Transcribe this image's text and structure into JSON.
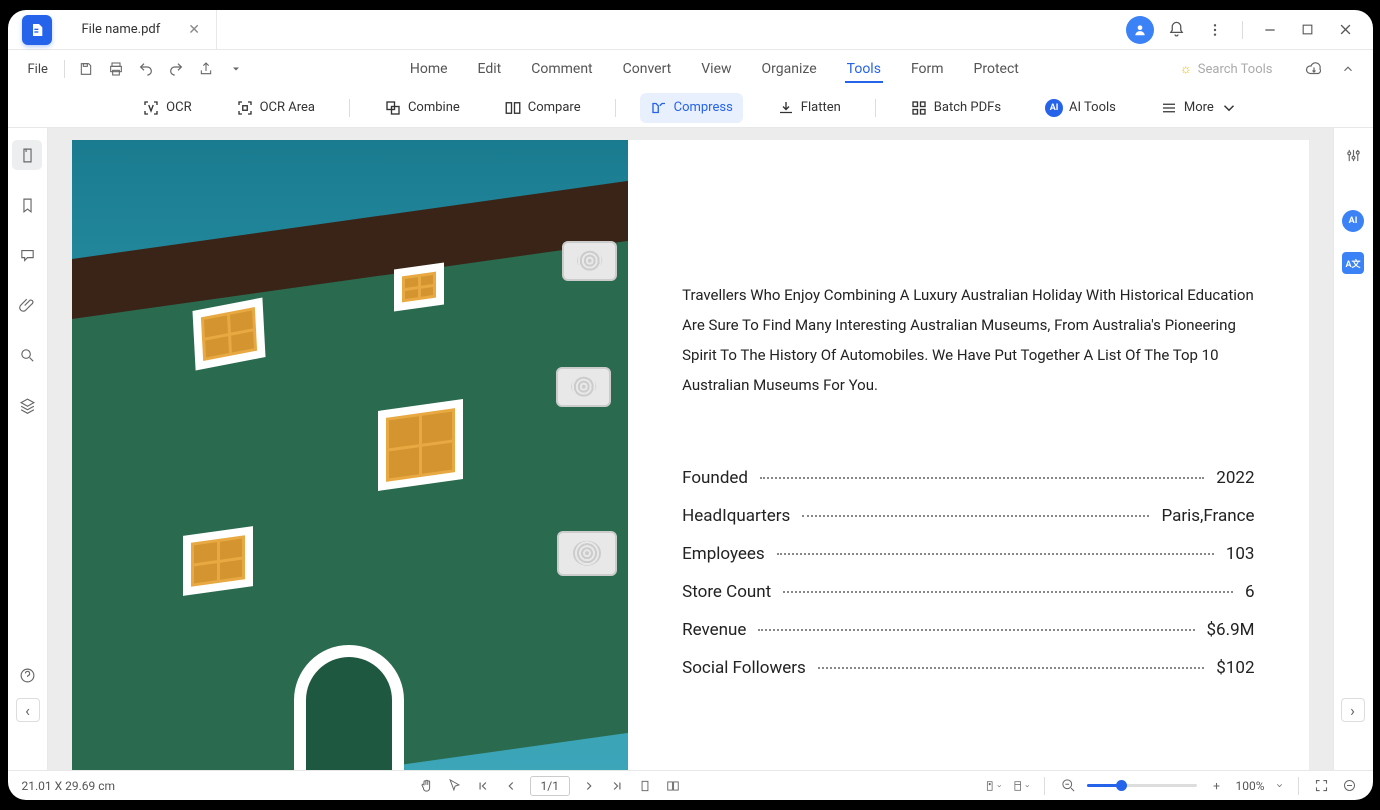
{
  "tab": {
    "filename": "File name.pdf"
  },
  "menubar": {
    "file": "File",
    "items": [
      "Home",
      "Edit",
      "Comment",
      "Convert",
      "View",
      "Organize",
      "Tools",
      "Form",
      "Protect"
    ],
    "active_index": 6,
    "search_placeholder": "Search Tools"
  },
  "toolbar": {
    "ocr": "OCR",
    "ocr_area": "OCR Area",
    "combine": "Combine",
    "compare": "Compare",
    "compress": "Compress",
    "flatten": "Flatten",
    "batch": "Batch PDFs",
    "ai_tools": "AI Tools",
    "more": "More",
    "active": "compress"
  },
  "document": {
    "body": "Travellers Who Enjoy Combining A Luxury Australian Holiday With Historical Education Are Sure To Find Many Interesting Australian Museums, From Australia's Pioneering Spirit To The History Of Automobiles. We Have Put Together A List Of The Top 10 Australian Museums For You.",
    "stats": [
      {
        "label": "Founded",
        "value": "2022"
      },
      {
        "label": "HeadIquarters",
        "value": "Paris,France"
      },
      {
        "label": "Employees",
        "value": "103"
      },
      {
        "label": "Store Count",
        "value": "6"
      },
      {
        "label": "Revenue",
        "value": "$6.9M"
      },
      {
        "label": "Social Followers",
        "value": "$102"
      }
    ]
  },
  "statusbar": {
    "dimensions": "21.01 X 29.69 cm",
    "page": "1/1",
    "zoom": "100%"
  }
}
